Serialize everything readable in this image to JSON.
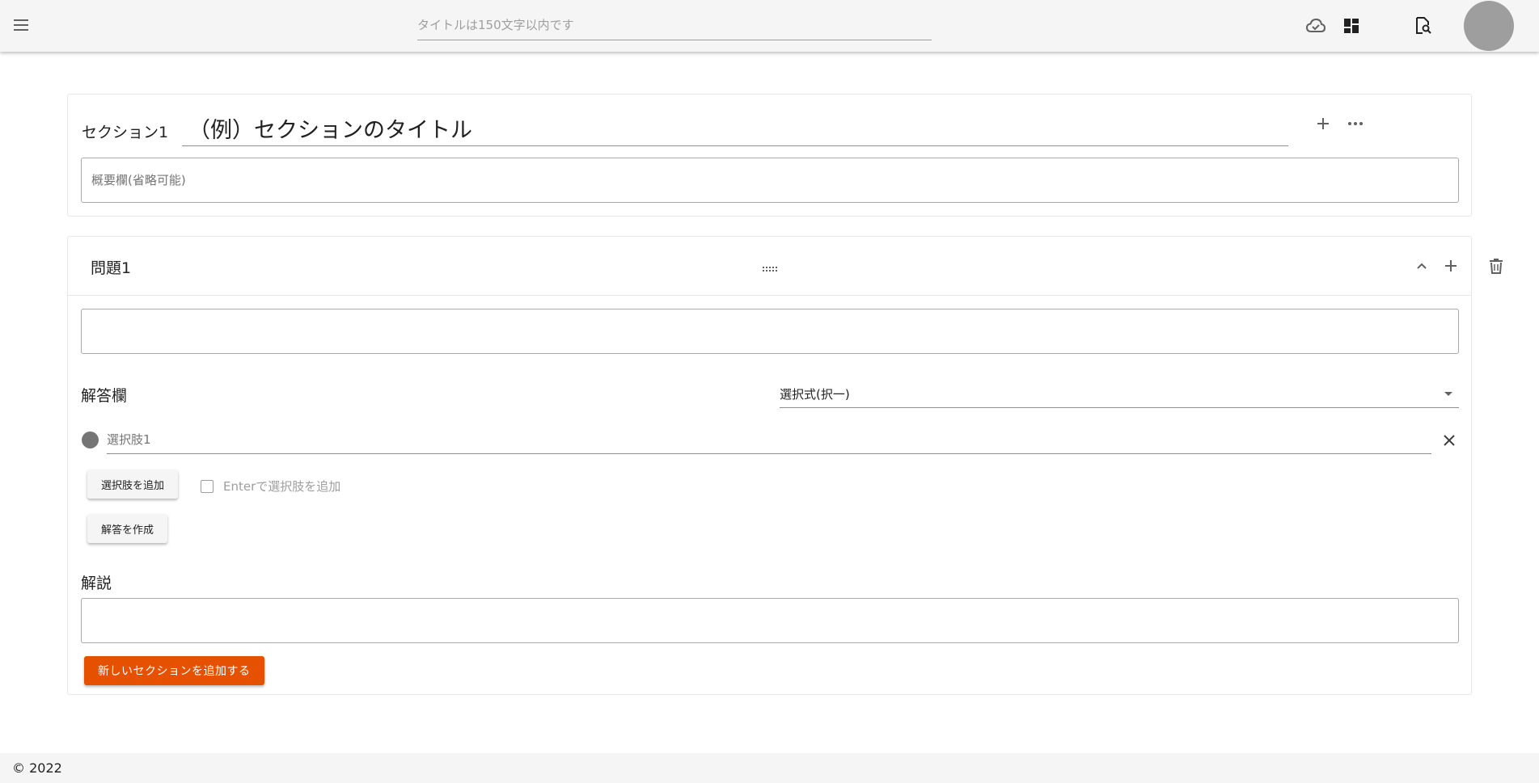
{
  "header": {
    "menu_icon": "hamburger-menu-icon",
    "title_placeholder": "タイトルは150文字以内です",
    "title_value": "",
    "icons": [
      "cloud-check-icon",
      "dashboard-icon",
      "document-search-icon"
    ]
  },
  "section": {
    "label": "セクション1",
    "title_value": "（例）セクションのタイトル",
    "summary_placeholder": "概要欄(省略可能)",
    "summary_value": ""
  },
  "question": {
    "label": "問題1",
    "text_value": "",
    "answer_label": "解答欄",
    "answer_type": "選択式(択一)",
    "choices": [
      {
        "placeholder": "選択肢1",
        "value": ""
      }
    ],
    "add_choice_label": "選択肢を追加",
    "enter_add_label": "Enterで選択肢を追加",
    "enter_add_checked": false,
    "make_answer_label": "解答を作成",
    "explanation_label": "解説",
    "explanation_value": "",
    "new_section_label": "新しいセクションを追加する"
  },
  "colors": {
    "accent": "#e65100",
    "header_bg": "#f5f5f5",
    "avatar": "#9e9e9e"
  },
  "footer": {
    "copyright": "© 2022"
  }
}
